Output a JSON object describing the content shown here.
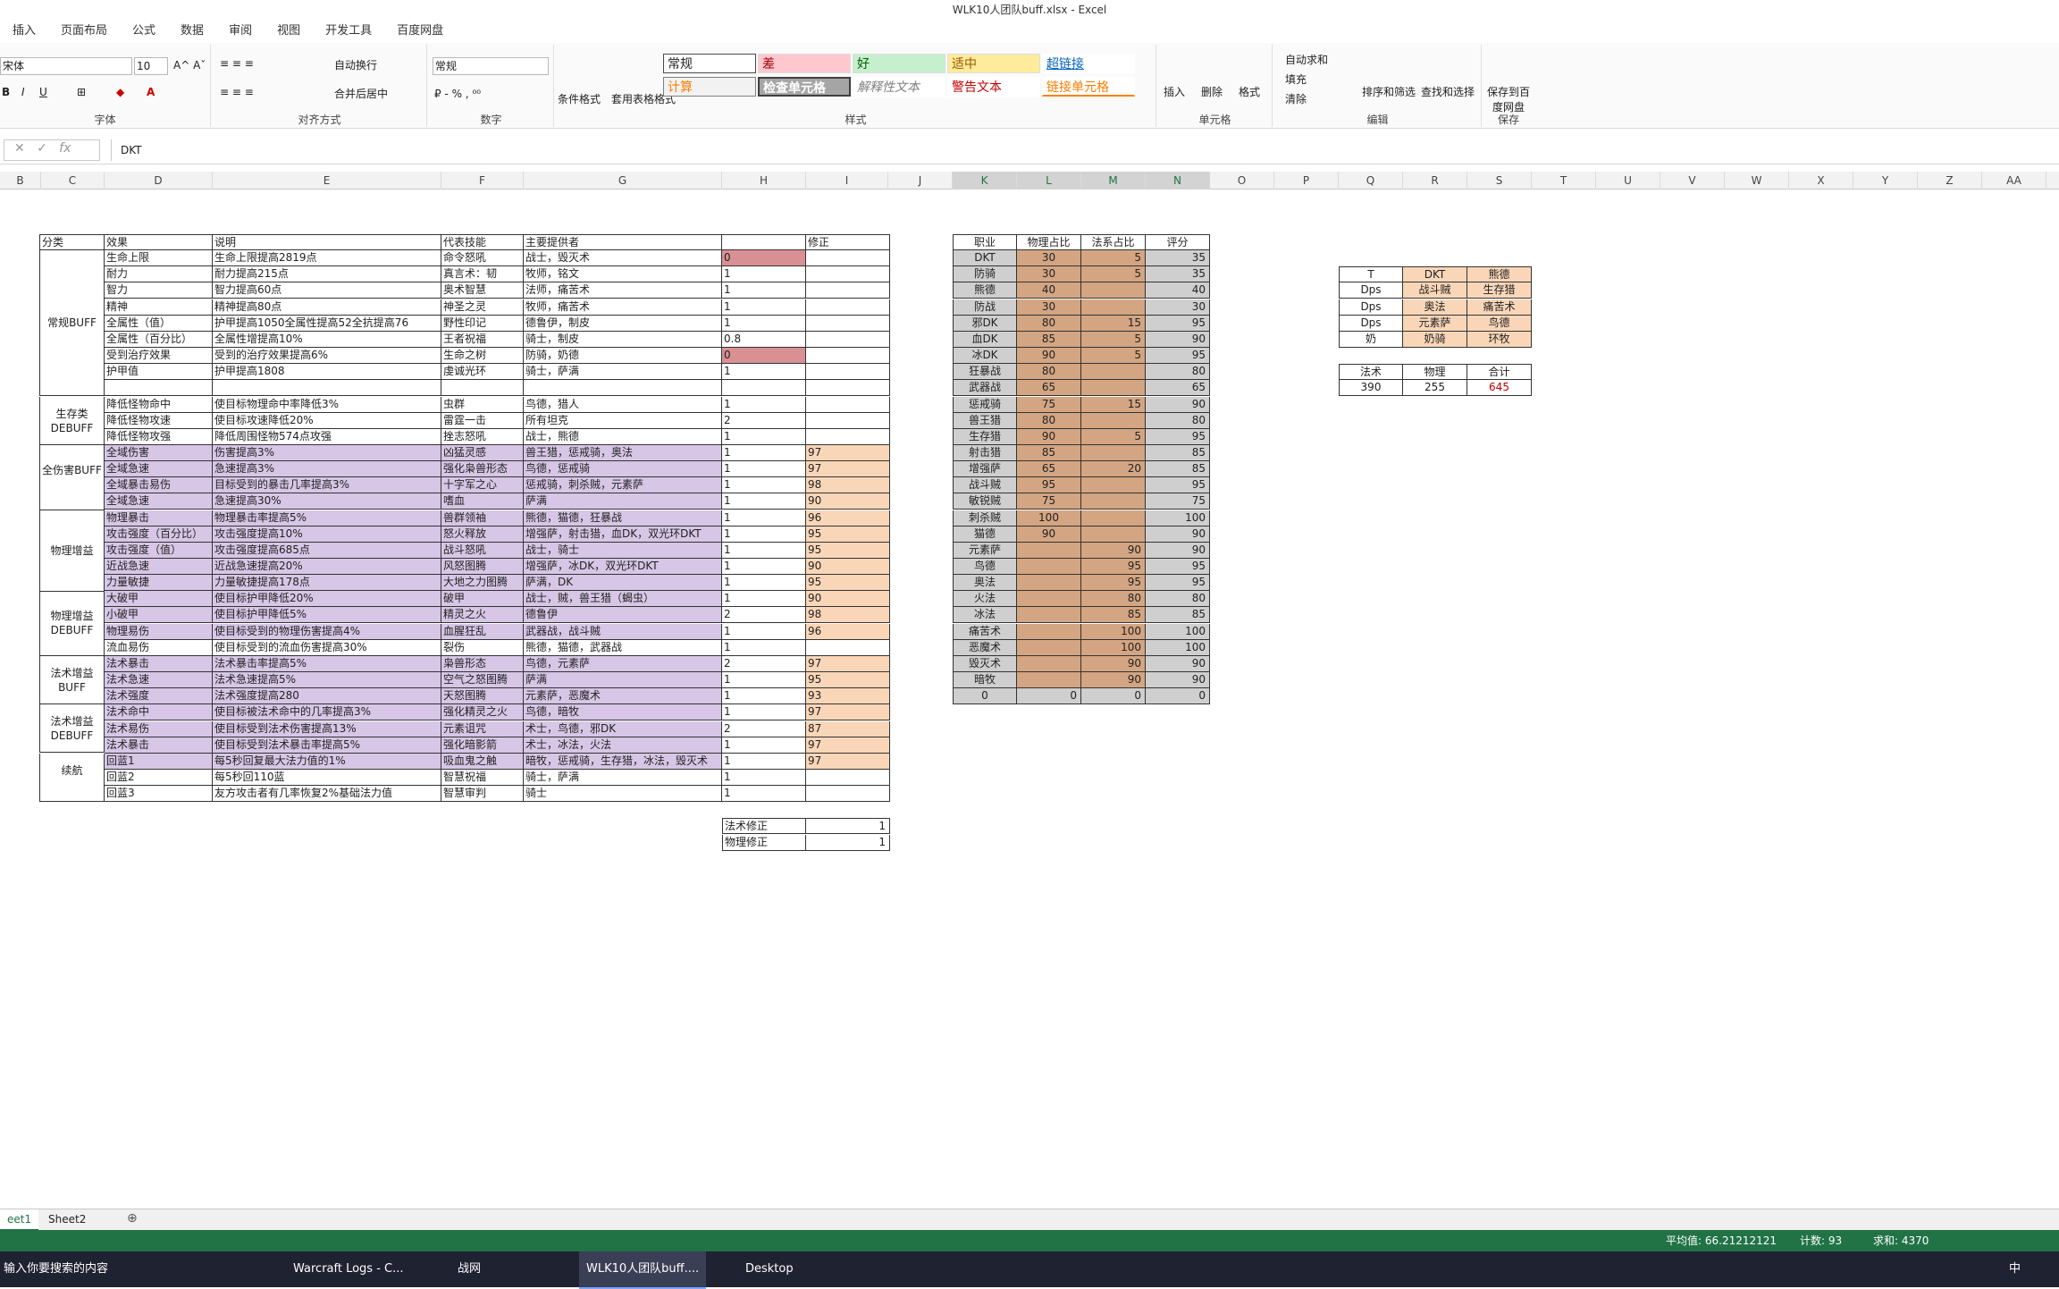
{
  "window": {
    "title": "WLK10人团队buff.xlsx - Excel"
  },
  "tabs": [
    "插入",
    "页面布局",
    "公式",
    "数据",
    "审阅",
    "视图",
    "开发工具",
    "百度网盘"
  ],
  "ribbon": {
    "font_name": "宋体",
    "font_size": "10",
    "number_format": "常规",
    "wrap": "自动换行",
    "merge": "合并后居中",
    "cond_format": "条件格式",
    "table_format": "套用表格格式",
    "styles": [
      "常规",
      "差",
      "好",
      "适中",
      "超链接",
      "计算",
      "检查单元格",
      "解释性文本",
      "警告文本",
      "链接单元格"
    ],
    "insert": "插入",
    "delete": "删除",
    "format": "格式",
    "autosum": "自动求和",
    "fill": "填充",
    "clear": "清除",
    "sort": "排序和筛选",
    "find": "查找和选择",
    "save_baidu": "保存到百度网盘",
    "groups": [
      "字体",
      "对齐方式",
      "数字",
      "样式",
      "单元格",
      "编辑",
      "保存"
    ]
  },
  "formula_bar": {
    "value": "DKT"
  },
  "columns": [
    "B",
    "C",
    "D",
    "E",
    "F",
    "G",
    "H",
    "I",
    "J",
    "K",
    "L",
    "M",
    "N",
    "O",
    "P",
    "Q",
    "R",
    "S",
    "T",
    "U",
    "V",
    "W",
    "X",
    "Y",
    "Z",
    "AA"
  ],
  "buff_table": {
    "headers": [
      "分类",
      "效果",
      "说明",
      "代表技能",
      "主要提供者",
      "",
      "修正"
    ],
    "categories": [
      {
        "label": "常规BUFF",
        "rows": 9
      },
      {
        "label": "生存类DEBUFF",
        "rows": 3
      },
      {
        "label": "全伤害BUFF",
        "rows": 4
      },
      {
        "label": "物理增益BUFF",
        "rows": 5
      },
      {
        "label": "物理增益DEBUFF",
        "rows": 4
      },
      {
        "label": "法术增益BUFF",
        "rows": 3
      },
      {
        "label": "法术增益DEBUFF",
        "rows": 3
      },
      {
        "label": "续航",
        "rows": 3
      }
    ],
    "rows": [
      [
        "生命上限",
        "生命上限提高2819点",
        "命令怒吼",
        "战士，毁灭术",
        "0",
        ""
      ],
      [
        "耐力",
        "耐力提高215点",
        "真言术：韧",
        "牧师，铭文",
        "1",
        ""
      ],
      [
        "智力",
        "智力提高60点",
        "奥术智慧",
        "法师，痛苦术",
        "1",
        ""
      ],
      [
        "精神",
        "精神提高80点",
        "神圣之灵",
        "牧师，痛苦术",
        "1",
        ""
      ],
      [
        "全属性（值）",
        "护甲提高1050全属性提高52全抗提高76",
        "野性印记",
        "德鲁伊，制皮",
        "1",
        ""
      ],
      [
        "全属性（百分比）",
        "全属性增提高10%",
        "王者祝福",
        "骑士，制皮",
        "0.8",
        ""
      ],
      [
        "受到治疗效果",
        "受到的治疗效果提高6%",
        "生命之树",
        "防骑，奶德",
        "0",
        ""
      ],
      [
        "护甲值",
        "护甲提高1808",
        "虔诚光环",
        "骑士，萨满",
        "1",
        ""
      ],
      [
        "",
        "",
        "",
        "",
        "",
        ""
      ],
      [
        "降低怪物命中",
        "使目标物理命中率降低3%",
        "虫群",
        "鸟德，猎人",
        "1",
        ""
      ],
      [
        "降低怪物攻速",
        "使目标攻速降低20%",
        "雷霆一击",
        "所有坦克",
        "2",
        ""
      ],
      [
        "降低怪物攻强",
        "降低周围怪物574点攻强",
        "挫志怒吼",
        "战士，熊德",
        "1",
        ""
      ],
      [
        "全域伤害",
        "伤害提高3%",
        "凶猛灵感",
        "兽王猎，惩戒骑，奥法",
        "1",
        "97"
      ],
      [
        "全域急速",
        "急速提高3%",
        "强化枭兽形态",
        "鸟德，惩戒骑",
        "1",
        "97"
      ],
      [
        "全域暴击易伤",
        "目标受到的暴击几率提高3%",
        "十字军之心",
        "惩戒骑，刺杀贼，元素萨",
        "1",
        "98"
      ],
      [
        "全域急速",
        "急速提高30%",
        "嗜血",
        "萨满",
        "1",
        "90"
      ],
      [
        "物理暴击",
        "物理暴击率提高5%",
        "兽群领袖",
        "熊德，猫德，狂暴战",
        "1",
        "96"
      ],
      [
        "攻击强度（百分比）",
        "攻击强度提高10%",
        "怒火释放",
        "增强萨，射击猎，血DK，双光环DKT",
        "1",
        "95"
      ],
      [
        "攻击强度（值）",
        "攻击强度提高685点",
        "战斗怒吼",
        "战士，骑士",
        "1",
        "95"
      ],
      [
        "近战急速",
        "近战急速提高20%",
        "风怒图腾",
        "增强萨，冰DK，双光环DKT",
        "1",
        "90"
      ],
      [
        "力量敏捷",
        "力量敏捷提高178点",
        "大地之力图腾",
        "萨满，DK",
        "1",
        "95"
      ],
      [
        "大破甲",
        "使目标护甲降低20%",
        "破甲",
        "战士，贼，兽王猎（蝎虫）",
        "1",
        "90"
      ],
      [
        "小破甲",
        "使目标护甲降低5%",
        "精灵之火",
        "德鲁伊",
        "2",
        "98"
      ],
      [
        "物理易伤",
        "使目标受到的物理伤害提高4%",
        "血腥狂乱",
        "武器战，战斗贼",
        "1",
        "96"
      ],
      [
        "流血易伤",
        "使目标受到的流血伤害提高30%",
        "裂伤",
        "熊德，猫德，武器战",
        "1",
        ""
      ],
      [
        "法术暴击",
        "法术暴击率提高5%",
        "枭兽形态",
        "鸟德，元素萨",
        "2",
        "97"
      ],
      [
        "法术急速",
        "法术急速提高5%",
        "空气之怒图腾",
        "萨满",
        "1",
        "95"
      ],
      [
        "法术强度",
        "法术强度提高280",
        "天怒图腾",
        "元素萨，恶魔术",
        "1",
        "93"
      ],
      [
        "法术命中",
        "使目标被法术命中的几率提高3%",
        "强化精灵之火",
        "鸟德，暗牧",
        "1",
        "97"
      ],
      [
        "法术易伤",
        "使目标受到法术伤害提高13%",
        "元素诅咒",
        "术士，鸟德，邪DK",
        "2",
        "87"
      ],
      [
        "法术暴击",
        "使目标受到法术暴击率提高5%",
        "强化暗影箭",
        "术士，冰法，火法",
        "1",
        "97"
      ],
      [
        "回蓝1",
        "每5秒回复最大法力值的1%",
        "吸血鬼之触",
        "暗牧，惩戒骑，生存猎，冰法，毁灭术",
        "1",
        "97"
      ],
      [
        "回蓝2",
        "每5秒回110蓝",
        "智慧祝福",
        "骑士，萨满",
        "1",
        ""
      ],
      [
        "回蓝3",
        "友方攻击者有几率恢复2%基础法力值",
        "智慧审判",
        "骑士",
        "1",
        ""
      ]
    ],
    "modifiers": [
      [
        "法术修正",
        "1"
      ],
      [
        "物理修正",
        "1"
      ]
    ]
  },
  "class_table": {
    "headers": [
      "职业",
      "物理占比",
      "法系占比",
      "评分"
    ],
    "rows": [
      [
        "DKT",
        "30",
        "5",
        "35"
      ],
      [
        "防骑",
        "30",
        "5",
        "35"
      ],
      [
        "熊德",
        "40",
        "",
        "40"
      ],
      [
        "防战",
        "30",
        "",
        "30"
      ],
      [
        "邪DK",
        "80",
        "15",
        "95"
      ],
      [
        "血DK",
        "85",
        "5",
        "90"
      ],
      [
        "冰DK",
        "90",
        "5",
        "95"
      ],
      [
        "狂暴战",
        "80",
        "",
        "80"
      ],
      [
        "武器战",
        "65",
        "",
        "65"
      ],
      [
        "惩戒骑",
        "75",
        "15",
        "90"
      ],
      [
        "兽王猎",
        "80",
        "",
        "80"
      ],
      [
        "生存猎",
        "90",
        "5",
        "95"
      ],
      [
        "射击猎",
        "85",
        "",
        "85"
      ],
      [
        "增强萨",
        "65",
        "20",
        "85"
      ],
      [
        "战斗贼",
        "95",
        "",
        "95"
      ],
      [
        "敏锐贼",
        "75",
        "",
        "75"
      ],
      [
        "刺杀贼",
        "100",
        "",
        "100"
      ],
      [
        "猫德",
        "90",
        "",
        "90"
      ],
      [
        "元素萨",
        "",
        "90",
        "90"
      ],
      [
        "鸟德",
        "",
        "95",
        "95"
      ],
      [
        "奥法",
        "",
        "95",
        "95"
      ],
      [
        "火法",
        "",
        "80",
        "80"
      ],
      [
        "冰法",
        "",
        "85",
        "85"
      ],
      [
        "痛苦术",
        "",
        "100",
        "100"
      ],
      [
        "恶魔术",
        "",
        "100",
        "100"
      ],
      [
        "毁灭术",
        "",
        "90",
        "90"
      ],
      [
        "暗牧",
        "",
        "90",
        "90"
      ],
      [
        "0",
        "0",
        "0",
        "0"
      ]
    ]
  },
  "team_table": {
    "rows": [
      [
        "T",
        "DKT",
        "熊德"
      ],
      [
        "Dps",
        "战斗贼",
        "生存猎"
      ],
      [
        "Dps",
        "奥法",
        "痛苦术"
      ],
      [
        "Dps",
        "元素萨",
        "鸟德"
      ],
      [
        "奶",
        "奶骑",
        "环牧"
      ]
    ],
    "totals_headers": [
      "法术",
      "物理",
      "合计"
    ],
    "totals": [
      "390",
      "255",
      "645"
    ]
  },
  "sheets": [
    "eet1",
    "Sheet2"
  ],
  "status": {
    "average": "平均值: 66.21212121",
    "count": "计数: 93",
    "sum": "求和: 4370"
  },
  "taskbar": {
    "search": "输入你要搜索的内容",
    "apps": [
      "Warcraft Logs - C...",
      "战网",
      "WLK10人团队buff....",
      "Desktop"
    ],
    "ime": "中"
  },
  "colors": {
    "accent": "#217346",
    "purple": "#d7c6e6",
    "orange": "#fad6b8",
    "pink": "#d99094",
    "brown": "#d4a582"
  }
}
